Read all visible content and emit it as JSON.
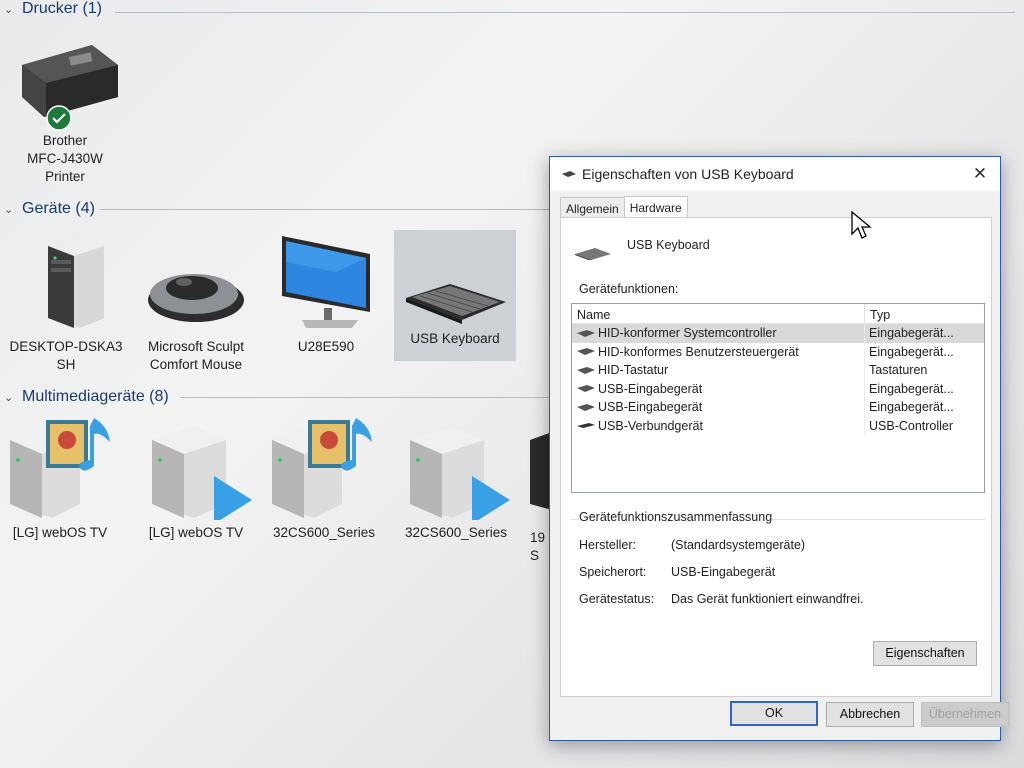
{
  "sections": {
    "printers": {
      "title": "Drucker (1)"
    },
    "devices": {
      "title": "Geräte (4)"
    },
    "multimedia": {
      "title": "Multimediageräte (8)"
    }
  },
  "printers": [
    {
      "label": "Brother\nMFC-J430W\nPrinter",
      "icon": "printer-icon",
      "status": "default-check"
    }
  ],
  "devices": [
    {
      "label": "DESKTOP-DSKA3\nSH",
      "icon": "computer-icon"
    },
    {
      "label": "Microsoft Sculpt\nComfort Mouse",
      "icon": "mouse-icon"
    },
    {
      "label": "U28E590",
      "icon": "monitor-icon"
    },
    {
      "label": "USB Keyboard",
      "icon": "keyboard-icon",
      "selected": true
    }
  ],
  "multimedia": [
    {
      "label": "[LG] webOS TV",
      "icon": "media-server-music-icon"
    },
    {
      "label": "[LG] webOS TV",
      "icon": "media-server-play-icon"
    },
    {
      "label": "32CS600_Series",
      "icon": "media-server-music-icon"
    },
    {
      "label": "32CS600_Series",
      "icon": "media-server-play-icon"
    },
    {
      "label": "19\nS",
      "icon": "media-server-icon"
    }
  ],
  "dialog": {
    "title": "Eigenschaften von USB Keyboard",
    "tabs": [
      "Allgemein",
      "Hardware"
    ],
    "active_tab": "Hardware",
    "device_name": "USB Keyboard",
    "functions_label": "Gerätefunktionen:",
    "columns": {
      "name": "Name",
      "type": "Typ"
    },
    "functions": [
      {
        "name": "HID-konformer Systemcontroller",
        "type": "Eingabegerät...",
        "selected": true
      },
      {
        "name": "HID-konformes Benutzersteuergerät",
        "type": "Eingabegerät..."
      },
      {
        "name": "HID-Tastatur",
        "type": "Tastaturen"
      },
      {
        "name": "USB-Eingabegerät",
        "type": "Eingabegerät..."
      },
      {
        "name": "USB-Eingabegerät",
        "type": "Eingabegerät..."
      },
      {
        "name": "USB-Verbundgerät",
        "type": "USB-Controller"
      }
    ],
    "summary_label": "Gerätefunktionszusammenfassung",
    "summary": {
      "manufacturer_key": "Hersteller:",
      "manufacturer_val": "(Standardsystemgeräte)",
      "location_key": "Speicherort:",
      "location_val": "USB-Eingabegerät",
      "status_key": "Gerätestatus:",
      "status_val": "Das Gerät funktioniert einwandfrei."
    },
    "properties_button": "Eigenschaften",
    "buttons": {
      "ok": "OK",
      "cancel": "Abbrechen",
      "apply": "Übernehmen"
    }
  },
  "colors": {
    "accent": "#2b66c8",
    "dialog_border": "#2a5aa8",
    "section_text": "#1a3a6a"
  }
}
